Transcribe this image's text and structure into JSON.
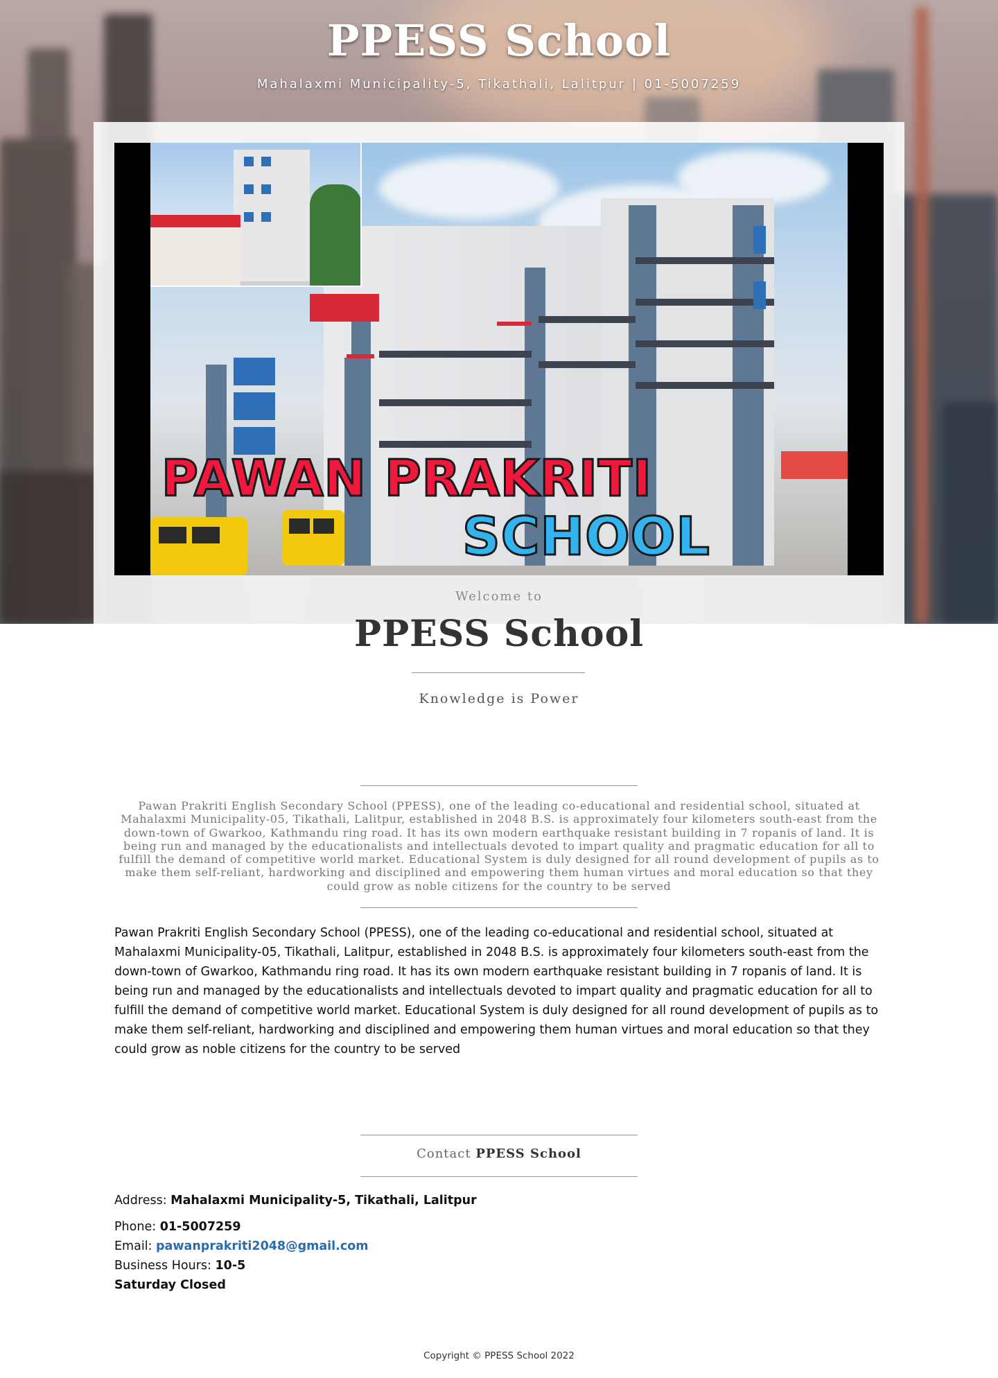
{
  "header": {
    "title": "PPESS School",
    "subtitle": "Mahalaxmi Municipality-5, Tikathali, Lalitpur | 01-5007259"
  },
  "hero": {
    "line1": "PAWAN PRAKRITI",
    "line2": "SCHOOL",
    "sign_text": "PAWAN PRAKRITI SCHOOL"
  },
  "welcome": {
    "small": "Welcome to",
    "big": "PPESS School",
    "tagline": "Knowledge is Power"
  },
  "intro": {
    "serif_text": "Pawan Prakriti English Secondary School (PPESS), one of the leading co-educational and residential school, situated at Mahalaxmi Municipality-05, Tikathali, Lalitpur, established in 2048 B.S. is approximately four kilometers south-east from the down-town of Gwarkoo, Kathmandu ring road. It has its own modern earthquake resistant building in 7 ropanis of land. It is being run and managed by the educationalists and intellectuals devoted to impart quality and pragmatic education for all to fulfill the demand of competitive world market. Educational System is duly designed for all round development of pupils as to make them self-reliant, hardworking and disciplined and empowering them human virtues and moral education so that they could grow as noble citizens for the country to be served",
    "body_text": "Pawan Prakriti English Secondary School (PPESS), one of the leading co-educational and residential school, situated at Mahalaxmi Municipality-05, Tikathali, Lalitpur, established in 2048 B.S. is approximately four kilometers south-east from the down-town of Gwarkoo, Kathmandu ring road. It has its own modern earthquake resistant building in 7 ropanis of land. It is being run and managed by the educationalists and intellectuals devoted to impart quality and pragmatic education for all to fulfill the demand of competitive world market. Educational System is duly designed for all round development of pupils as to make them self-reliant, hardworking and disciplined and empowering them human virtues and moral education so that they could grow as noble citizens for the country to be served"
  },
  "contact": {
    "title_prefix": "Contact",
    "title_name": "PPESS School",
    "address_label": "Address:",
    "address_value": "Mahalaxmi Municipality-5, Tikathali, Lalitpur",
    "phone_label": "Phone:",
    "phone_value": "01-5007259",
    "email_label": "Email:",
    "email_value": "pawanprakriti2048@gmail.com",
    "hours_label": "Business Hours:",
    "hours_value": "10-5",
    "closed_note": "Saturday Closed"
  },
  "footer": {
    "copyright": "Copyright © PPESS School 2022"
  },
  "colors": {
    "link": "#2a6cb0",
    "hero_red": "#f0193d",
    "hero_blue": "#34b4ee"
  }
}
